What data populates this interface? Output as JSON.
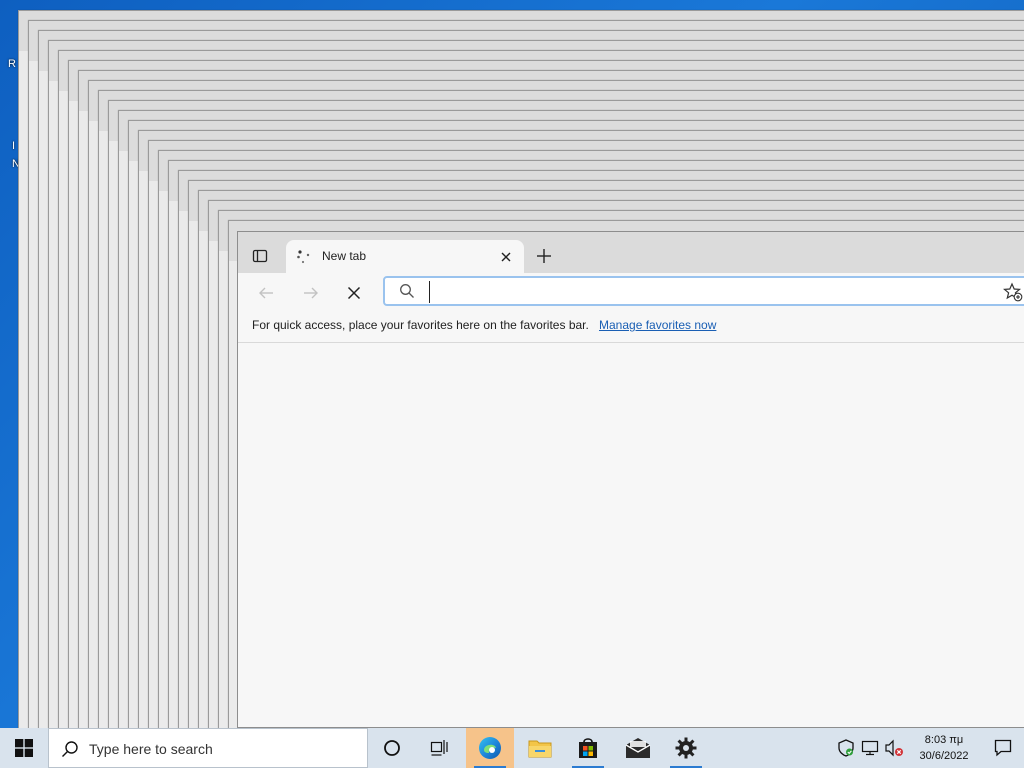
{
  "desktop": {
    "fragments": [
      "R",
      "I",
      "N"
    ]
  },
  "browser": {
    "tab": {
      "title": "New tab",
      "close_label": "×"
    },
    "address_bar": {
      "value": "",
      "placeholder": ""
    },
    "favorites_bar": {
      "message": "For quick access, place your favorites here on the favorites bar.",
      "link_label": "Manage favorites now"
    }
  },
  "taskbar": {
    "search_placeholder": "Type here to search",
    "apps": [
      {
        "name": "cortana-icon"
      },
      {
        "name": "task-view-icon"
      },
      {
        "name": "edge-icon",
        "active": true
      },
      {
        "name": "file-explorer-icon"
      },
      {
        "name": "microsoft-store-icon"
      },
      {
        "name": "mail-icon"
      },
      {
        "name": "settings-icon"
      }
    ],
    "clock": {
      "time": "8:03 πμ",
      "date": "30/6/2022"
    }
  },
  "colors": {
    "taskbar_bg": "#d9e3ed",
    "active_app": "#f6c38a",
    "accent": "#2b7bd1",
    "link": "#1a5fb4"
  }
}
